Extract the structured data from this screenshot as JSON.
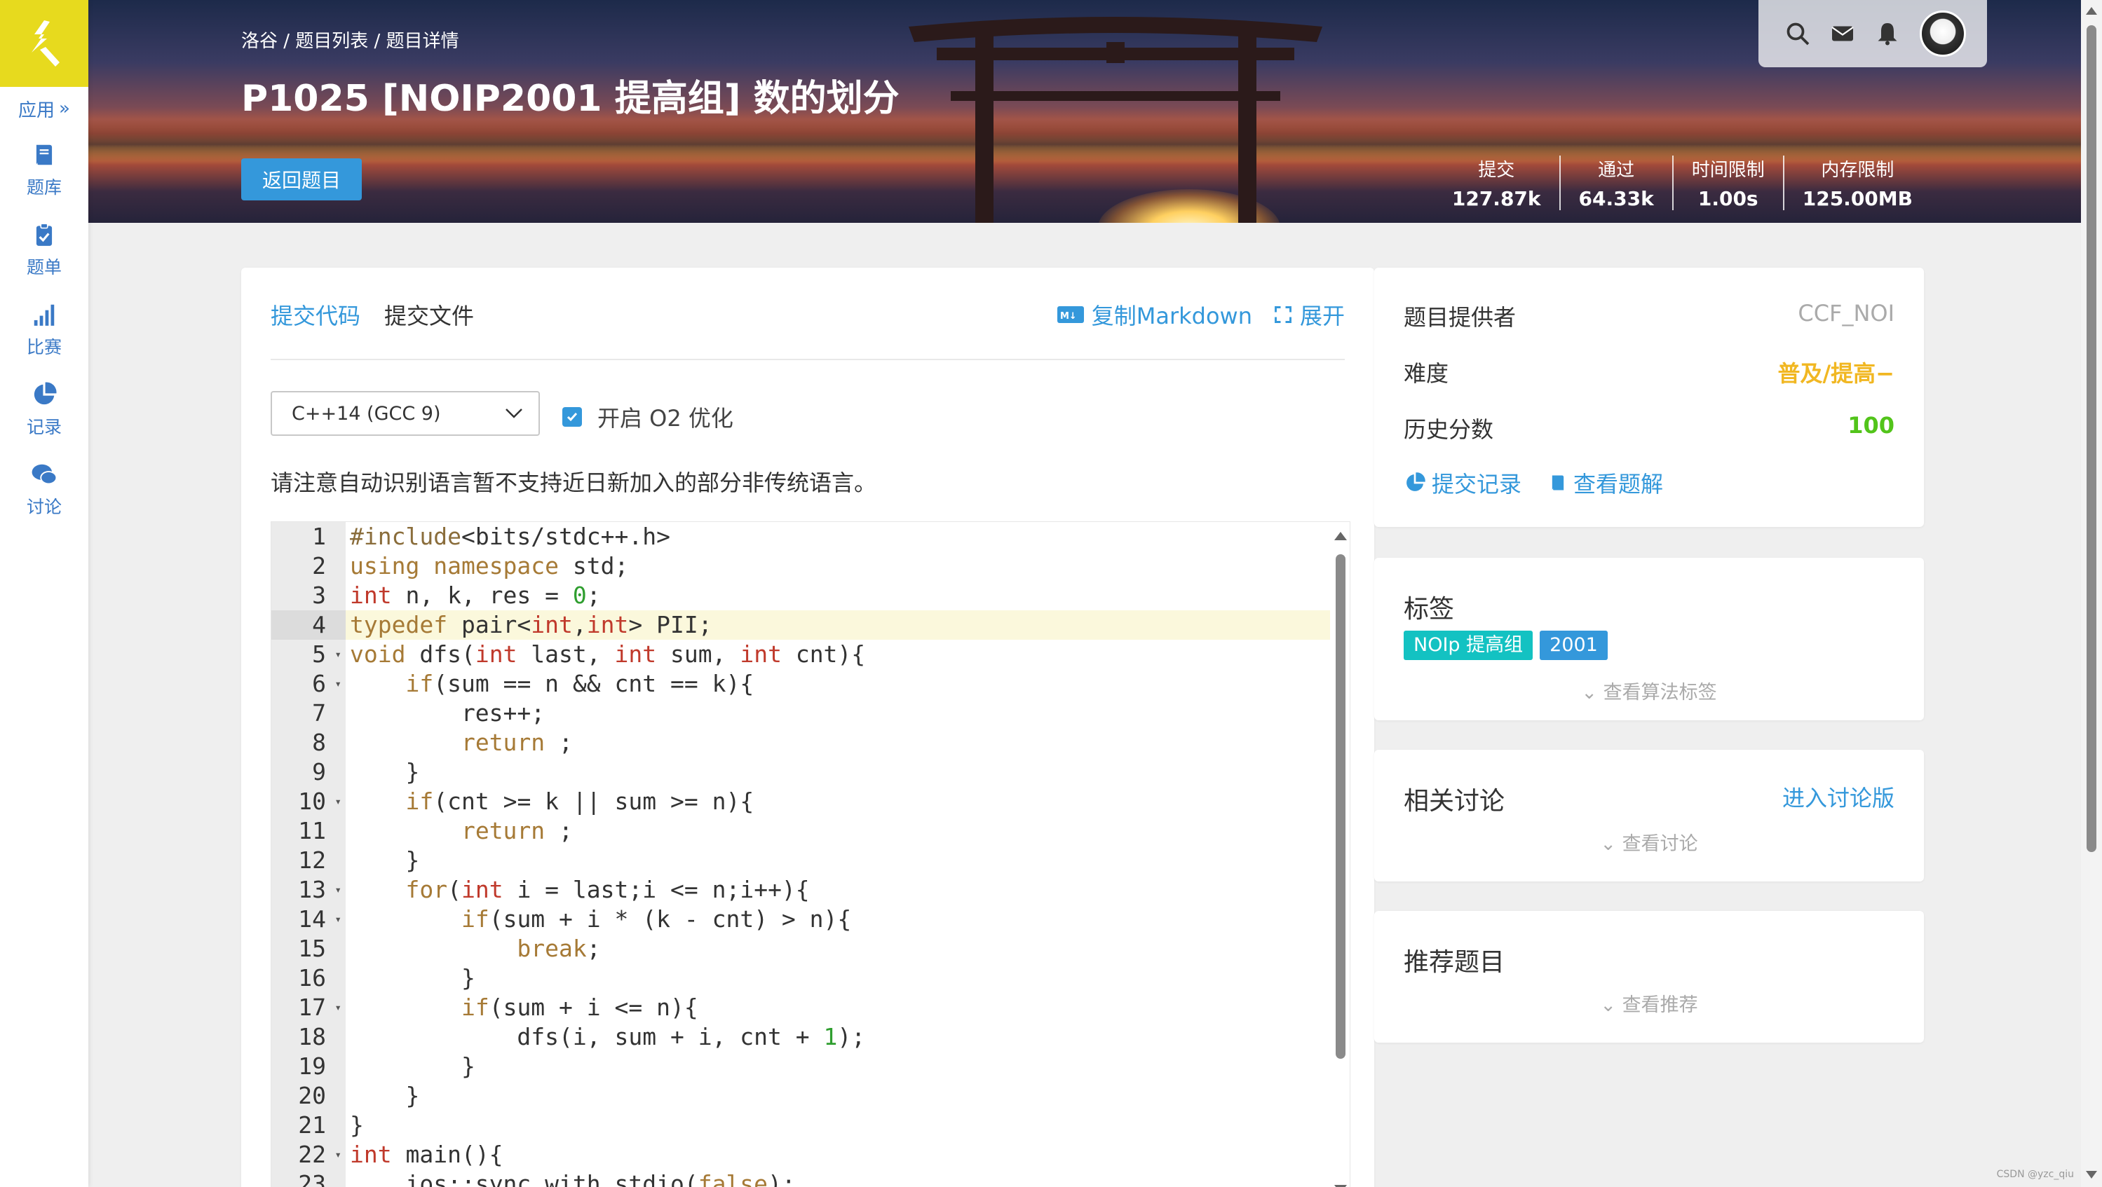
{
  "sidebar": {
    "apps_label": "应用",
    "items": [
      {
        "label": "题库",
        "icon": "book-icon"
      },
      {
        "label": "题单",
        "icon": "clipboard-icon"
      },
      {
        "label": "比赛",
        "icon": "bar-chart-icon"
      },
      {
        "label": "记录",
        "icon": "pie-chart-icon"
      },
      {
        "label": "讨论",
        "icon": "chat-icon"
      }
    ]
  },
  "header": {
    "breadcrumb": "洛谷 / 题目列表 / 题目详情",
    "title": "P1025 [NOIP2001 提高组] 数的划分",
    "back_button": "返回题目",
    "stats": [
      {
        "label": "提交",
        "value": "127.87k"
      },
      {
        "label": "通过",
        "value": "64.33k"
      },
      {
        "label": "时间限制",
        "value": "1.00s"
      },
      {
        "label": "内存限制",
        "value": "125.00MB"
      }
    ]
  },
  "editor_card": {
    "tab_submit_code": "提交代码",
    "tab_submit_file": "提交文件",
    "copy_markdown": "复制Markdown",
    "expand": "展开",
    "language": "C++14 (GCC 9)",
    "o2_label": "开启 O2 优化",
    "o2_checked": true,
    "notice": "请注意自动识别语言暂不支持近日新加入的部分非传统语言。",
    "active_line": 4
  },
  "code_lines": [
    "#include<bits/stdc++.h>",
    "using namespace std;",
    "int n, k, res = 0;",
    "typedef pair<int,int> PII;",
    "void dfs(int last, int sum, int cnt){",
    "    if(sum == n && cnt == k){",
    "        res++;",
    "        return ;",
    "    }",
    "    if(cnt >= k || sum >= n){",
    "        return ;",
    "    }",
    "    for(int i = last;i <= n;i++){",
    "        if(sum + i * (k - cnt) > n){",
    "            break;",
    "        }",
    "        if(sum + i <= n){",
    "            dfs(i, sum + i, cnt + 1);",
    "        }",
    "    }",
    "}",
    "int main(){",
    "    ios::sync_with_stdio(false);"
  ],
  "fold_lines": [
    5,
    6,
    10,
    13,
    14,
    17,
    22
  ],
  "info_card": {
    "provider_label": "题目提供者",
    "provider_value": "CCF_NOI",
    "difficulty_label": "难度",
    "difficulty_value": "普及/提高−",
    "history_label": "历史分数",
    "history_value": "100",
    "submissions_link": "提交记录",
    "solutions_link": "查看题解"
  },
  "tags_card": {
    "title": "标签",
    "tags": [
      {
        "label": "NOIp 提高组",
        "color": "#13c2c2"
      },
      {
        "label": "2001",
        "color": "#3498db"
      }
    ],
    "more": "查看算法标签"
  },
  "discussion_card": {
    "title": "相关讨论",
    "enter": "进入讨论版",
    "more": "查看讨论"
  },
  "recommend_card": {
    "title": "推荐题目",
    "more": "查看推荐"
  },
  "watermark": "CSDN @yzc_qiu",
  "colors": {
    "accent": "#3498db",
    "logo_bg": "#e7da1e",
    "difficulty": "#f1b722",
    "score": "#52c41a"
  }
}
